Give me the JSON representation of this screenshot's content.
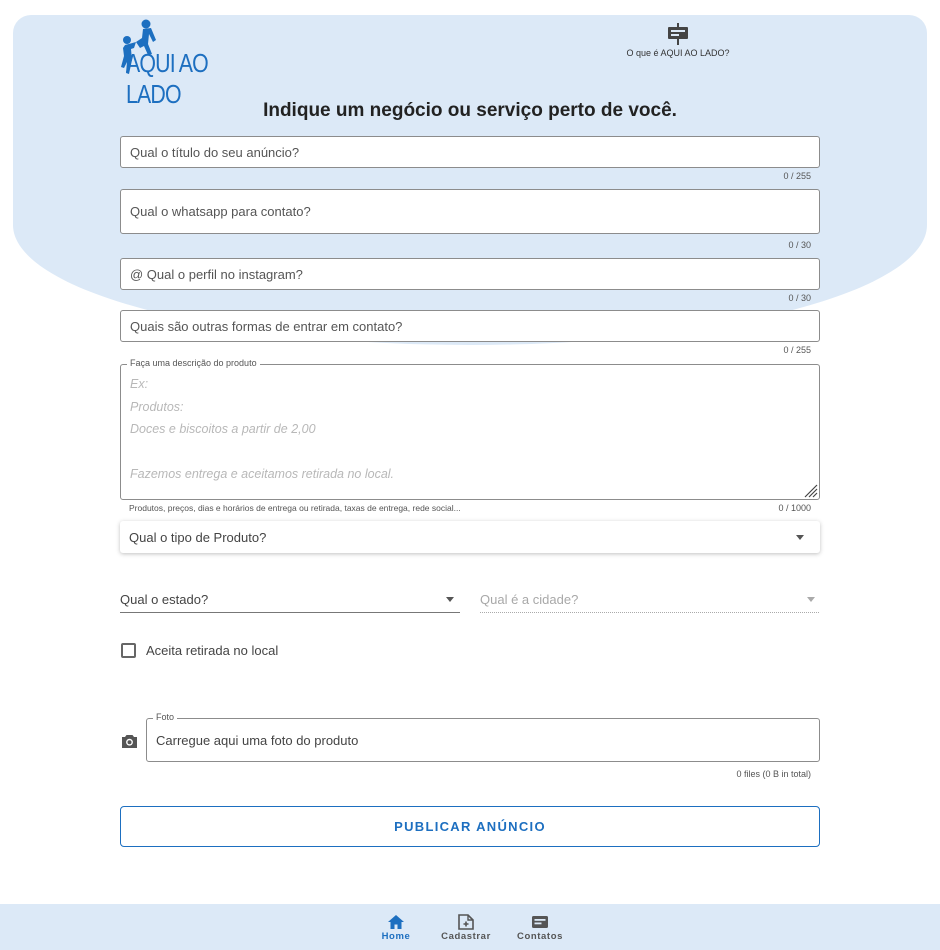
{
  "brand": {
    "name": "AQUI AO LADO",
    "accent": "#1d6fc0",
    "background": "#dce9f7"
  },
  "header": {
    "about_label": "O que é AQUI AO LADO?",
    "about_icon": "signpost-icon"
  },
  "page": {
    "heading": "Indique um negócio ou serviço perto de você."
  },
  "form": {
    "title": {
      "placeholder": "Qual o título do seu anúncio?",
      "counter": "0 / 255"
    },
    "whatsapp": {
      "placeholder": "Qual o whatsapp para contato?",
      "counter": "0 / 30"
    },
    "instagram": {
      "placeholder": "@ Qual o perfil no instagram?",
      "counter": "0 / 30"
    },
    "other_contacts": {
      "placeholder": "Quais são outras formas de entrar em contato?",
      "counter": "0 / 255"
    },
    "description": {
      "label": "Faça uma descrição do produto",
      "placeholder": "Ex:\nProdutos:\nDoces e biscoitos a partir de 2,00\n\nFazemos entrega e aceitamos retirada no local.",
      "hint": "Produtos, preços, dias e horários de entrega ou retirada, taxas de entrega, rede social...",
      "counter": "0 / 1000"
    },
    "product_type": {
      "placeholder": "Qual o tipo de Produto?"
    },
    "state": {
      "placeholder": "Qual o estado?"
    },
    "city": {
      "placeholder": "Qual é a cidade?"
    },
    "pickup": {
      "label": "Aceita retirada no local",
      "checked": false
    },
    "photo": {
      "label": "Foto",
      "placeholder": "Carregue aqui uma foto do produto",
      "total": "0 files (0 B in total)",
      "icon": "camera-icon"
    },
    "submit_label": "PUBLICAR ANÚNCIO"
  },
  "bottom_nav": {
    "items": [
      {
        "label": "Home",
        "icon": "home-icon",
        "active": true
      },
      {
        "label": "Cadastrar",
        "icon": "add-document-icon",
        "active": false
      },
      {
        "label": "Contatos",
        "icon": "contacts-card-icon",
        "active": false
      }
    ]
  }
}
